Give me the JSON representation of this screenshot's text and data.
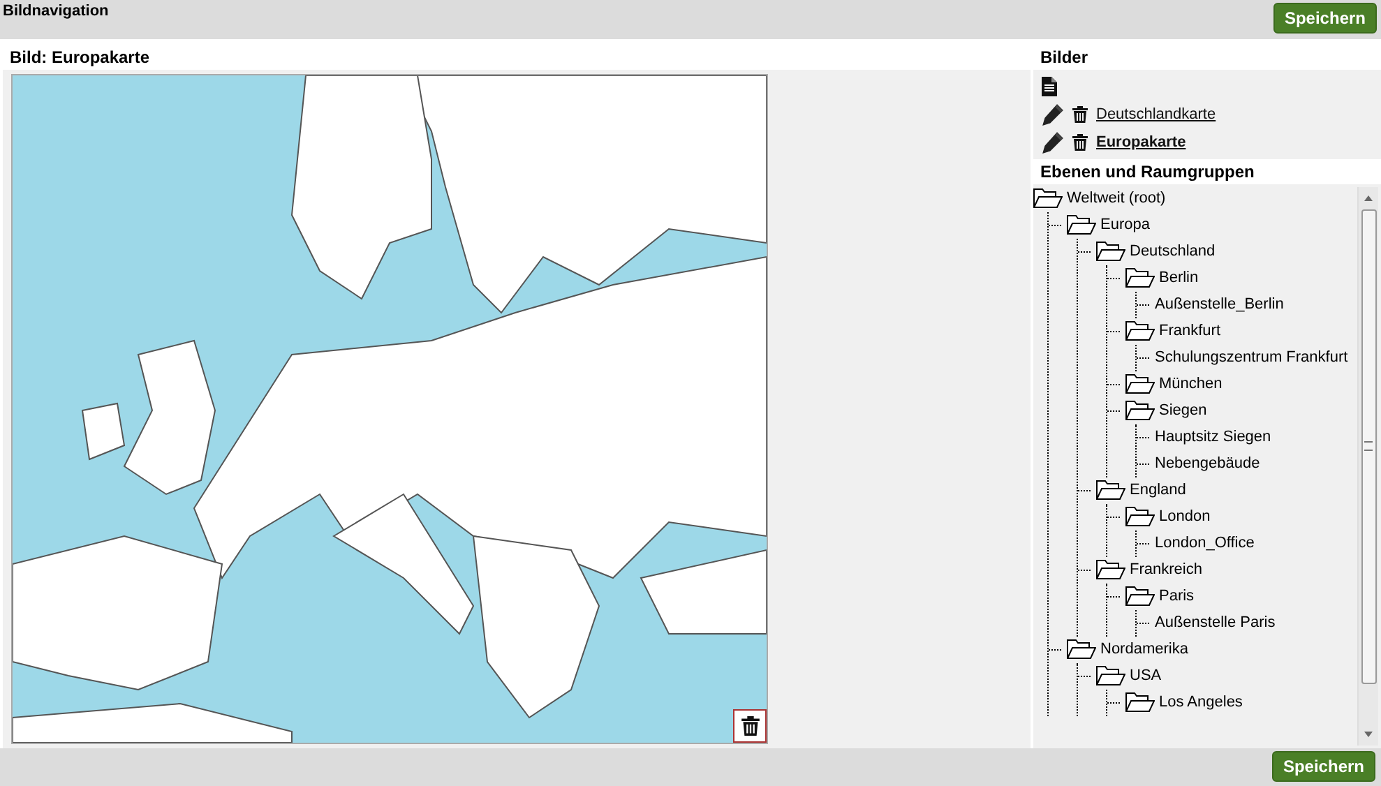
{
  "header": {
    "title": "Bildnavigation",
    "save_button": "Speichern"
  },
  "image_panel": {
    "title": "Bild: Europakarte"
  },
  "images": {
    "title": "Bilder",
    "items": [
      {
        "name": "Deutschlandkarte",
        "selected": false
      },
      {
        "name": "Europakarte",
        "selected": true
      }
    ]
  },
  "tree": {
    "title": "Ebenen und Raumgruppen",
    "items": [
      {
        "label": "Weltweit (root)",
        "kind": "folder",
        "children": [
          {
            "label": "Europa",
            "kind": "folder",
            "children": [
              {
                "label": "Deutschland",
                "kind": "folder",
                "children": [
                  {
                    "label": "Berlin",
                    "kind": "folder",
                    "children": [
                      {
                        "label": "Außenstelle_Berlin",
                        "kind": "leaf"
                      }
                    ]
                  },
                  {
                    "label": "Frankfurt",
                    "kind": "folder",
                    "children": [
                      {
                        "label": "Schulungszentrum Frankfurt",
                        "kind": "leaf"
                      }
                    ]
                  },
                  {
                    "label": "München",
                    "kind": "folder"
                  },
                  {
                    "label": "Siegen",
                    "kind": "folder",
                    "children": [
                      {
                        "label": "Hauptsitz Siegen",
                        "kind": "leaf"
                      },
                      {
                        "label": "Nebengebäude",
                        "kind": "leaf"
                      }
                    ]
                  }
                ]
              },
              {
                "label": "England",
                "kind": "folder",
                "children": [
                  {
                    "label": "London",
                    "kind": "folder",
                    "children": [
                      {
                        "label": "London_Office",
                        "kind": "leaf"
                      }
                    ]
                  }
                ]
              },
              {
                "label": "Frankreich",
                "kind": "folder",
                "children": [
                  {
                    "label": "Paris",
                    "kind": "folder",
                    "children": [
                      {
                        "label": "Außenstelle Paris",
                        "kind": "leaf"
                      }
                    ]
                  }
                ]
              }
            ]
          },
          {
            "label": "Nordamerika",
            "kind": "folder",
            "children": [
              {
                "label": "USA",
                "kind": "folder",
                "children": [
                  {
                    "label": "Los Angeles",
                    "kind": "folder"
                  }
                ]
              }
            ]
          }
        ]
      }
    ]
  },
  "footer": {
    "save_button": "Speichern"
  }
}
